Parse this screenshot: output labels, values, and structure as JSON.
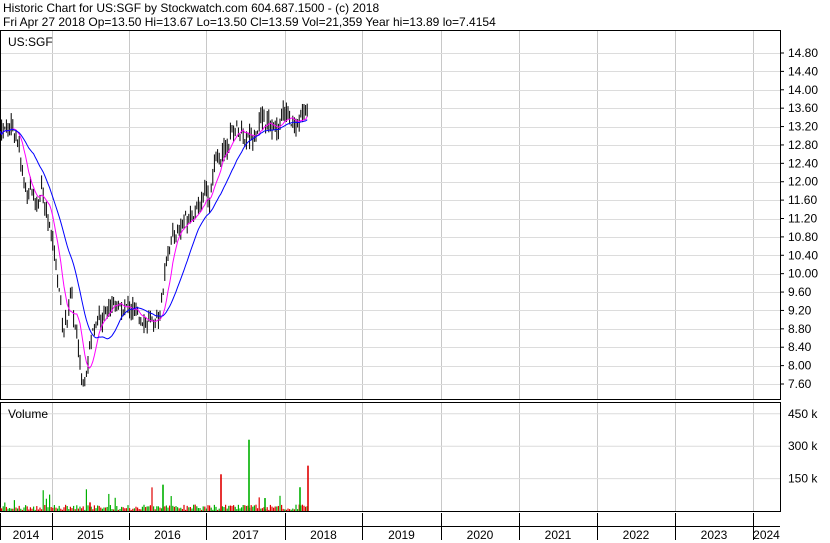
{
  "header": {
    "line1": "Historic Chart for US:SGF by Stockwatch.com 604.687.1500 - (c) 2018",
    "line2": "Fri Apr 27 2018   Op=13.50   Hi=13.67   Lo=13.50   Cl=13.59   Vol=21,359   Year hi=13.89   lo=7.4154"
  },
  "chart_data": [
    {
      "type": "candlestick",
      "title": "US:SGF",
      "ylim": [
        7.2,
        15.0
      ],
      "yticks": [
        "14.80",
        "14.40",
        "14.00",
        "13.60",
        "13.20",
        "12.80",
        "12.40",
        "12.00",
        "11.60",
        "11.20",
        "10.80",
        "10.40",
        "10.00",
        "9.60",
        "9.20",
        "8.80",
        "8.40",
        "8.00",
        "7.60"
      ],
      "series": [
        {
          "x": [
            2014.0,
            2014.1,
            2014.2,
            2014.3,
            2014.35,
            2014.45,
            2014.55,
            2014.6,
            2014.7,
            2014.75,
            2014.8,
            2014.85,
            2014.9,
            2015.0,
            2015.1,
            2015.15,
            2015.2,
            2015.25,
            2015.3,
            2015.35,
            2015.4,
            2015.45,
            2015.5,
            2015.55,
            2015.6,
            2015.65,
            2015.7,
            2015.75,
            2015.8,
            2015.85,
            2015.9,
            2016.0,
            2016.1,
            2016.2,
            2016.3,
            2016.4,
            2016.5,
            2016.6,
            2016.7,
            2016.8,
            2016.9,
            2017.0,
            2017.05,
            2017.1,
            2017.2,
            2017.25,
            2017.3,
            2017.4,
            2017.5,
            2017.6,
            2017.7,
            2017.8,
            2017.9,
            2018.0,
            2018.1,
            2018.2,
            2018.3
          ],
          "values": [
            13.1,
            13.15,
            13.2,
            13.1,
            12.8,
            12.1,
            11.7,
            11.9,
            11.5,
            11.7,
            11.9,
            11.5,
            11.2,
            10.8,
            9.6,
            8.8,
            9.0,
            9.6,
            8.8,
            8.3,
            7.6,
            8.0,
            8.5,
            8.9,
            9.1,
            8.9,
            9.3,
            9.2,
            9.4,
            9.3,
            9.2,
            9.3,
            9.1,
            9.0,
            8.9,
            9.1,
            10.5,
            10.9,
            11.1,
            11.3,
            11.4,
            11.9,
            11.6,
            12.3,
            12.6,
            12.7,
            13.0,
            13.2,
            12.9,
            13.0,
            13.4,
            13.3,
            13.1,
            13.6,
            13.2,
            13.4,
            13.7
          ]
        },
        {
          "name": "",
          "color": "#ff00ff"
        },
        {
          "name": "",
          "color": "#0000ff"
        }
      ]
    },
    {
      "type": "bar",
      "title": "Volume",
      "ylim": [
        0,
        500
      ],
      "yticks": [
        "450 k",
        "300 k",
        "150 k"
      ],
      "colors": {
        "up": "#00b000",
        "down": "#e00000"
      }
    }
  ],
  "xaxis": {
    "labels": [
      "2014",
      "2015",
      "2016",
      "2017",
      "2018",
      "2019",
      "2020",
      "2021",
      "2022",
      "2023",
      "2024"
    ]
  }
}
